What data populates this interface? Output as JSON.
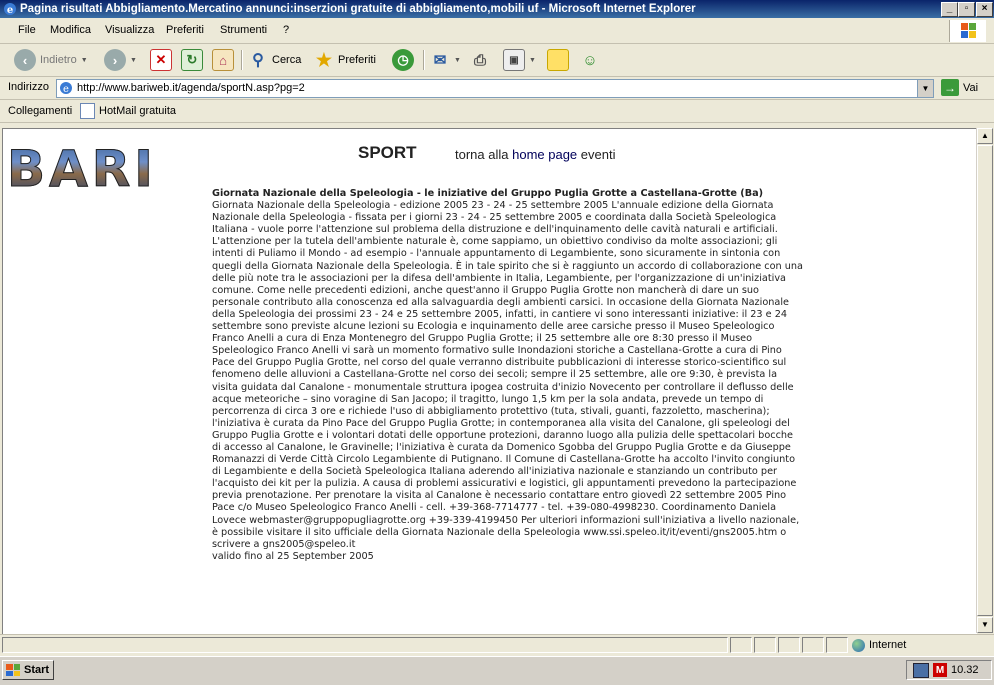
{
  "window": {
    "title": "Pagina risultati Abbigliamento.Mercatino annunci:inserzioni gratuite di abbigliamento,mobili uf - Microsoft Internet Explorer",
    "min": "_",
    "max": "▫",
    "close": "×"
  },
  "menu": [
    "File",
    "Modifica",
    "Visualizza",
    "Preferiti",
    "Strumenti",
    "?"
  ],
  "toolbar": {
    "back": "Indietro",
    "search": "Cerca",
    "favorites": "Preferiti"
  },
  "address": {
    "label": "Indirizzo",
    "url": "http://www.bariweb.it/agenda/sportN.asp?pg=2",
    "go": "Vai"
  },
  "links": {
    "label": "Collegamenti",
    "item": "HotMail gratuita"
  },
  "page": {
    "logo": "BARI",
    "section": "SPORT",
    "back_prefix": "torna alla",
    "back_link": "home page",
    "back_suffix": "eventi",
    "article_title": "Giornata Nazionale della Speleologia - le iniziative del Gruppo Puglia Grotte a Castellana-Grotte (Ba)",
    "article_body": "Giornata Nazionale della Speleologia - edizione 2005 23 - 24 - 25 settembre 2005 L'annuale edizione della Giornata Nazionale della Speleologia - fissata per i giorni 23 - 24 - 25 settembre 2005 e coordinata dalla Società Speleologica Italiana - vuole porre l'attenzione sul problema della distruzione e dell'inquinamento delle cavità naturali e artificiali. L'attenzione per la tutela dell'ambiente naturale è, come sappiamo, un obiettivo condiviso da molte associazioni; gli intenti di Puliamo il Mondo - ad esempio - l'annuale appuntamento di Legambiente, sono sicuramente in sintonia con quegli della Giornata Nazionale della Speleologia. È in tale spirito che si è raggiunto un accordo di collaborazione con una delle più note tra le associazioni per la difesa dell'ambiente in Italia, Legambiente, per l'organizzazione di un'iniziativa comune. Come nelle precedenti edizioni, anche quest'anno il Gruppo Puglia Grotte non mancherà di dare un suo personale contributo alla conoscenza ed alla salvaguardia degli ambienti carsici. In occasione della Giornata Nazionale della Speleologia dei prossimi 23 - 24 e 25 settembre 2005, infatti, in cantiere vi sono interessanti iniziative: il 23 e 24 settembre sono previste alcune lezioni su Ecologia e inquinamento delle aree carsiche presso il Museo Speleologico Franco Anelli a cura di Enza Montenegro del Gruppo Puglia Grotte; il 25 settembre alle ore 8:30 presso il Museo Speleologico Franco Anelli vi sarà un momento formativo sulle Inondazioni storiche a Castellana-Grotte a cura di Pino Pace del Gruppo Puglia Grotte, nel corso del quale verranno distribuite pubblicazioni di interesse storico-scientifico sul fenomeno delle alluvioni a Castellana-Grotte nel corso dei secoli; sempre il 25 settembre, alle ore 9:30, è prevista la visita guidata dal Canalone - monumentale struttura ipogea costruita d'inizio Novecento per controllare il deflusso delle acque meteoriche – sino voragine di San Jacopo; il tragitto, lungo 1,5 km per la sola andata, prevede un tempo di percorrenza di circa 3 ore e richiede l'uso di abbigliamento protettivo (tuta, stivali, guanti, fazzoletto, mascherina); l'iniziativa è curata da Pino Pace del Gruppo Puglia Grotte; in contemporanea alla visita del Canalone, gli speleologi del Gruppo Puglia Grotte e i volontari dotati delle opportune protezioni, daranno luogo alla pulizia delle spettacolari bocche di accesso al Canalone, le Gravinelle; l'iniziativa è curata da Domenico Sgobba del Gruppo Puglia Grotte e da Giuseppe Romanazzi di Verde Città Circolo Legambiente di Putignano. Il Comune di Castellana-Grotte ha accolto l'invito congiunto di Legambiente e della Società Speleologica Italiana aderendo all'iniziativa nazionale e stanziando un contributo per l'acquisto dei kit per la pulizia. A causa di problemi assicurativi e logistici, gli appuntamenti prevedono la partecipazione previa prenotazione. Per prenotare la visita al Canalone è necessario contattare entro giovedì 22 settembre 2005 Pino Pace c/o Museo Speleologico Franco Anelli - cell. +39-368-7714777 - tel. +39-080-4998230. Coordinamento Daniela Lovece webmaster@gruppopugliagrotte.org +39-339-4199450 Per ulteriori informazioni sull'iniziativa a livello nazionale, è possibile visitare il sito ufficiale della Giornata Nazionale della Speleologia www.ssi.speleo.it/it/eventi/gns2005.htm o scrivere a gns2005@speleo.it",
    "valid_until": "valido fino al 25 September 2005"
  },
  "status": {
    "zone": "Internet"
  },
  "taskbar": {
    "start": "Start",
    "clock": "10.32"
  }
}
